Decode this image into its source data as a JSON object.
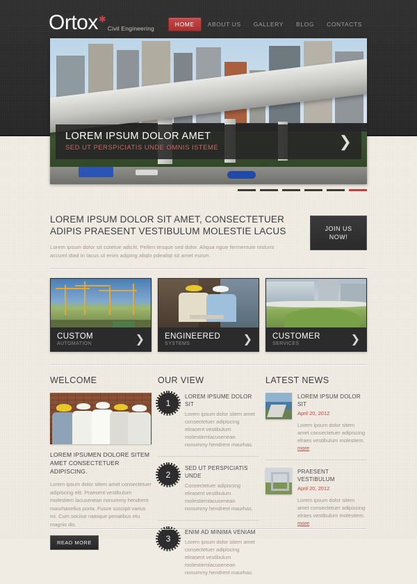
{
  "header": {
    "logo_name": "Ortox",
    "logo_star": "✱",
    "logo_tagline": "Civil Engineering",
    "nav": [
      {
        "label": "HOME",
        "active": true
      },
      {
        "label": "ABOUT US",
        "active": false
      },
      {
        "label": "GALLERY",
        "active": false
      },
      {
        "label": "BLOG",
        "active": false
      },
      {
        "label": "CONTACTS",
        "active": false
      }
    ]
  },
  "slider": {
    "caption_title": "LOREM IPSUM DOLOR AMET",
    "caption_subtitle": "SED UT PERSPICIATIS UNDE OMNIS ISTEME",
    "next_arrow": "❯",
    "pager_count": 6,
    "pager_active_index": 5,
    "active_color": "#c33a3a"
  },
  "intro": {
    "heading": "LOREM IPSUM DOLOR SIT AMET, CONSECTETUER ADIPIS PRAESENT VESTIBULUM MOLESTIE LACUS",
    "paragraph": "Lorem ipsum dolor sit cotetue adiclit. Pellen tesque sed dolor. Aliqua ngue fermentum nisluris accuml diad in lacus ut enim adiping aliqln pdealiqt sit amet euism.",
    "cta_line1": "JOIN US",
    "cta_line2": "NOW!"
  },
  "cards": [
    {
      "title": "CUSTOM",
      "subtitle": "AUTOMATION",
      "arrow": "❯",
      "image": "construction-cranes-photo"
    },
    {
      "title": "ENGINEERED",
      "subtitle": "SYSTEMS",
      "arrow": "❯",
      "image": "engineers-with-helmets-photo"
    },
    {
      "title": "CUSTOMER",
      "subtitle": "SERVICES",
      "arrow": "❯",
      "image": "modern-building-photo"
    }
  ],
  "welcome": {
    "heading": "WELCOME",
    "image": "team-of-engineers-photo",
    "title": "LOREM IPSUMEN DOLORE SITEM AMET CONSECTETUER ADIPISCING.",
    "body": "Lorem ipsum dolor sitem amet consectetuer adipiscing elit. Praesent vestibulum molestiem lacusenean nonummy hendrent maurhasellus porta. Fusce suscipit varius mi. Cum sociise natoque penatibus etu magnis dis.",
    "button": "READ MORE"
  },
  "our_view": {
    "heading": "OUR VIEW",
    "items": [
      {
        "number": "1",
        "title": "LOREM IPSUME DOLOR SIT",
        "text": "Lorem ipsum dolor sitem amet consectetuer adipiscing elirasent vestibulum molestiemlacusenean nonummy hendrent maurhas."
      },
      {
        "number": "2",
        "title": "SED UT PERSPICIATIS UNDE",
        "text": "Consectetuer adipiscing elirasent vestibulum molestiemlacusenean nonummy hendrent maurhas."
      },
      {
        "number": "3",
        "title": "ENIM AD MINIMA VENIAM",
        "text": "Lorem ipsum dolor sitem amet consectetuer adipiscing elirasent vestibulum molestiemlacusenean nonummy hendrent maurhas."
      }
    ]
  },
  "latest_news": {
    "heading": "LATEST NEWS",
    "more_label": "more",
    "items": [
      {
        "title": "LOREM IPSUM DOLOR SIT",
        "date": "April 20, 2012",
        "text": "Lorem ipsum dolor sitem amet consectetuer adipiscing elraes vestibulum molestiem.",
        "thumb": "dam-photo"
      },
      {
        "title": "PRAESENT VESTIBULUM",
        "date": "April 20, 2012",
        "text": "Lorem ipsum dolor sitem amet consectetuer adipiscing elraes vestibulum molestiem.",
        "thumb": "bridge-photo"
      }
    ]
  }
}
